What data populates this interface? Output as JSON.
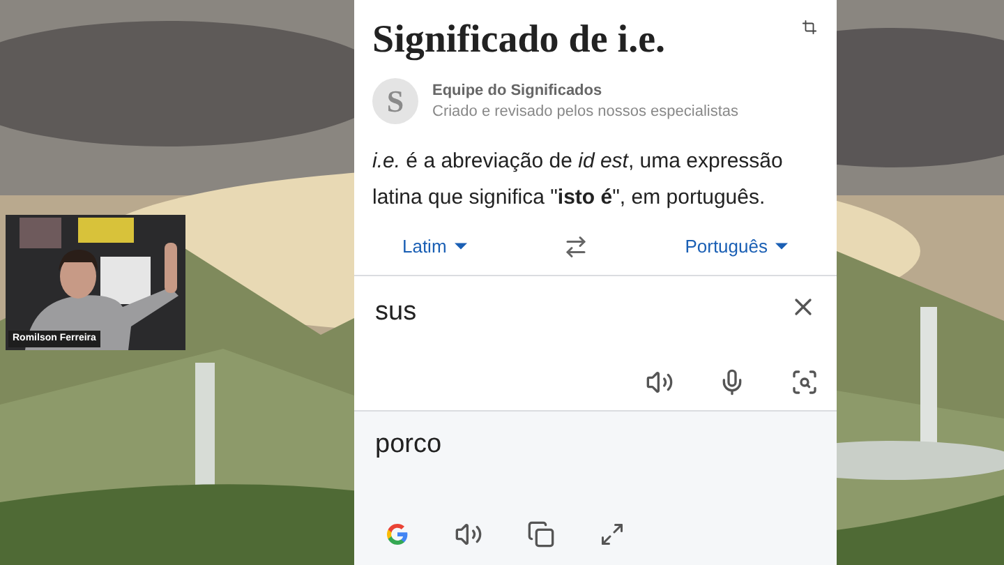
{
  "webcam": {
    "name": "Romilson Ferreira"
  },
  "article": {
    "title": "Significado de i.e.",
    "author": {
      "avatar_letter": "S",
      "name": "Equipe do Significados",
      "subtitle": "Criado e revisado pelos nossos especialistas"
    },
    "definition": "*i.e.* é a abreviação de *id est*, uma expressão latina que significa \"**isto é**\", em português."
  },
  "translator": {
    "source_language": "Latim",
    "target_language": "Português",
    "input": {
      "value": "sus"
    },
    "output": "porco"
  }
}
